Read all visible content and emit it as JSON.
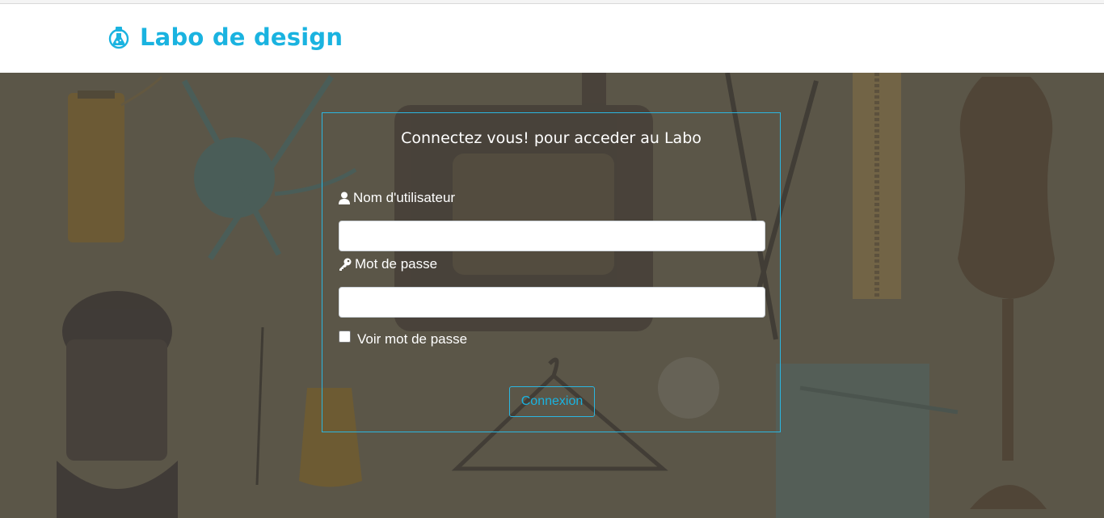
{
  "brand": {
    "name": "Labo de design",
    "icon": "flask-icon",
    "color": "#1ab3e0"
  },
  "hero": {
    "background_color": "#5b5648"
  },
  "login": {
    "title": "Connectez vous! pour acceder au Labo",
    "username": {
      "label": "Nom d'utilisateur",
      "icon": "user-icon",
      "value": "",
      "placeholder": ""
    },
    "password": {
      "label": "Mot de passe",
      "icon": "key-icon",
      "value": "",
      "placeholder": ""
    },
    "show_password": {
      "label": "Voir mot de passe",
      "checked": false
    },
    "submit_label": "Connexion",
    "accent": "#2bb6e0"
  }
}
